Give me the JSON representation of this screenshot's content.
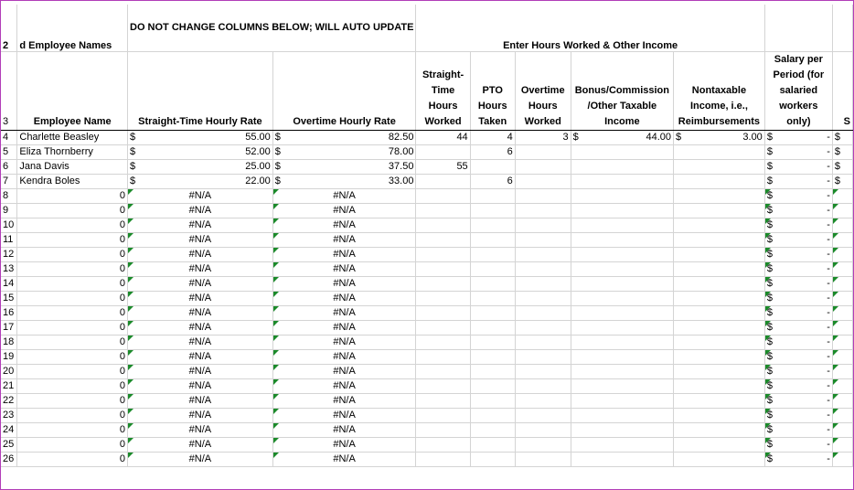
{
  "header_row": {
    "row_label": "2",
    "employee_names": "d Employee Names",
    "warning": "DO NOT CHANGE COLUMNS BELOW; WILL AUTO UPDATE",
    "enter_hours": "Enter Hours Worked & Other Income"
  },
  "columns": {
    "row_label": "3",
    "employee_name": "Employee Name",
    "straight_rate": "Straight-Time Hourly Rate",
    "overtime_rate": "Overtime Hourly Rate",
    "straight_hours": "Straight-Time Hours Worked",
    "pto_hours": "PTO Hours Taken",
    "overtime_hours": "Overtime Hours Worked",
    "bonus": "Bonus/Commission /Other Taxable Income",
    "nontaxable": "Nontaxable Income, i.e., Reimbursements",
    "salary": "Salary per Period (for salaried workers only)",
    "last_partial": "S"
  },
  "employees": [
    {
      "row": "4",
      "name": "Charlette Beasley",
      "st_sym": "$",
      "st_rate": "55.00",
      "ot_sym": "$",
      "ot_rate": "82.50",
      "st_hours": "44",
      "pto": "4",
      "ot_hours": "3",
      "bonus_sym": "$",
      "bonus": "44.00",
      "nt_sym": "$",
      "nt": "3.00",
      "sal_sym": "$",
      "sal": "-",
      "last": "$"
    },
    {
      "row": "5",
      "name": "Eliza Thornberry",
      "st_sym": "$",
      "st_rate": "52.00",
      "ot_sym": "$",
      "ot_rate": "78.00",
      "st_hours": "",
      "pto": "6",
      "ot_hours": "",
      "bonus_sym": "",
      "bonus": "",
      "nt_sym": "",
      "nt": "",
      "sal_sym": "$",
      "sal": "-",
      "last": "$"
    },
    {
      "row": "6",
      "name": "Jana Davis",
      "st_sym": "$",
      "st_rate": "25.00",
      "ot_sym": "$",
      "ot_rate": "37.50",
      "st_hours": "55",
      "pto": "",
      "ot_hours": "",
      "bonus_sym": "",
      "bonus": "",
      "nt_sym": "",
      "nt": "",
      "sal_sym": "$",
      "sal": "-",
      "last": "$"
    },
    {
      "row": "7",
      "name": "Kendra Boles",
      "st_sym": "$",
      "st_rate": "22.00",
      "ot_sym": "$",
      "ot_rate": "33.00",
      "st_hours": "",
      "pto": "6",
      "ot_hours": "",
      "bonus_sym": "",
      "bonus": "",
      "nt_sym": "",
      "nt": "",
      "sal_sym": "$",
      "sal": "-",
      "last": "$"
    }
  ],
  "blank_rows": {
    "rows": [
      "8",
      "9",
      "10",
      "11",
      "12",
      "13",
      "14",
      "15",
      "16",
      "17",
      "18",
      "19",
      "20",
      "21",
      "22",
      "23",
      "24",
      "25",
      "26"
    ],
    "name_value": "0",
    "na_value": "#N/A",
    "sal_sym": "$",
    "sal_value": "-"
  }
}
